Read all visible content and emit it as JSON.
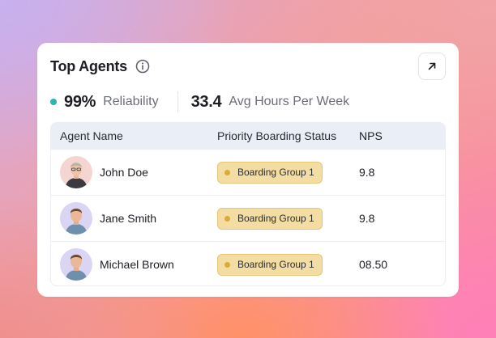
{
  "card": {
    "title": "Top Agents",
    "info_icon": "info-icon",
    "expand_icon": "arrow-up-right-icon"
  },
  "stats": [
    {
      "value": "99%",
      "label": "Reliability",
      "dot_color": "#2bb5ac"
    },
    {
      "value": "33.4",
      "label": "Avg Hours Per Week"
    }
  ],
  "table": {
    "columns": [
      "Agent Name",
      "Priority Boarding Status",
      "NPS"
    ],
    "rows": [
      {
        "name": "John Doe",
        "status": "Boarding Group 1",
        "nps": "9.8",
        "avatar_bg": "#f4d5d2"
      },
      {
        "name": "Jane Smith",
        "status": "Boarding Group 1",
        "nps": "9.8",
        "avatar_bg": "#d9d5f3"
      },
      {
        "name": "Michael Brown",
        "status": "Boarding Group 1",
        "nps": "08.50",
        "avatar_bg": "#d9d5f3"
      }
    ]
  },
  "colors": {
    "badge_bg": "#f3dda3",
    "badge_dot": "#d9ab3c",
    "header_bg": "#eaeef6"
  }
}
